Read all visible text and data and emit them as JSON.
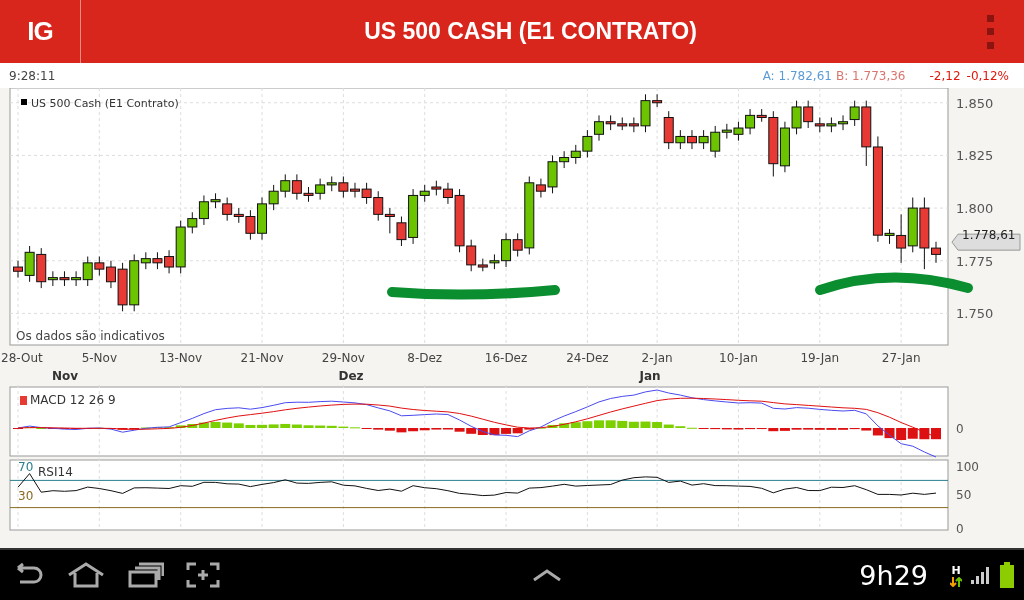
{
  "header": {
    "logo": "IG",
    "title": "US 500 CASH (E1 CONTRATO)"
  },
  "quote": {
    "time": "9:28:11",
    "ask_label": "A:",
    "ask": "1.782,61",
    "bid_label": "B:",
    "bid": "1.773,36",
    "change": "-2,12",
    "change_pct": "-0,12%"
  },
  "price_chart": {
    "legend": "US 500 Cash (E1 Contrato)",
    "note": "Os dados são indicativos",
    "last_price": "1.778,61",
    "chart_data": {
      "type": "candlestick",
      "categories": [
        "28-Out",
        null,
        null,
        null,
        null,
        null,
        null,
        "5-Nov",
        null,
        null,
        null,
        null,
        null,
        null,
        "13-Nov",
        null,
        null,
        null,
        null,
        null,
        null,
        "21-Nov",
        null,
        null,
        null,
        null,
        null,
        null,
        "29-Nov",
        null,
        null,
        null,
        null,
        null,
        null,
        "8-Dez",
        null,
        null,
        null,
        null,
        null,
        null,
        "16-Dez",
        null,
        null,
        null,
        null,
        null,
        null,
        "24-Dez",
        null,
        null,
        null,
        null,
        null,
        "2-Jan",
        null,
        null,
        null,
        null,
        null,
        null,
        "10-Jan",
        null,
        null,
        null,
        null,
        null,
        null,
        "19-Jan",
        null,
        null,
        null,
        null,
        null,
        null,
        "27-Jan",
        null,
        null,
        null
      ],
      "ohlc": [
        [
          1772,
          1775,
          1767,
          1770
        ],
        [
          1768,
          1782,
          1765,
          1779
        ],
        [
          1778,
          1781,
          1762,
          1765
        ],
        [
          1766,
          1770,
          1763,
          1767
        ],
        [
          1767,
          1770,
          1763,
          1766
        ],
        [
          1766,
          1770,
          1763,
          1767
        ],
        [
          1766,
          1777,
          1763,
          1774
        ],
        [
          1774,
          1777,
          1768,
          1771
        ],
        [
          1772,
          1775,
          1762,
          1765
        ],
        [
          1771,
          1774,
          1751,
          1754
        ],
        [
          1754,
          1778,
          1751,
          1775
        ],
        [
          1774,
          1779,
          1771,
          1776
        ],
        [
          1776,
          1779,
          1771,
          1774
        ],
        [
          1777,
          1780,
          1769,
          1772
        ],
        [
          1772,
          1794,
          1769,
          1791
        ],
        [
          1791,
          1798,
          1788,
          1795
        ],
        [
          1795,
          1806,
          1792,
          1803
        ],
        [
          1803,
          1807,
          1800,
          1804
        ],
        [
          1802,
          1805,
          1794,
          1797
        ],
        [
          1797,
          1800,
          1793,
          1796
        ],
        [
          1796,
          1799,
          1785,
          1788
        ],
        [
          1788,
          1805,
          1785,
          1802
        ],
        [
          1802,
          1811,
          1799,
          1808
        ],
        [
          1808,
          1816,
          1805,
          1813
        ],
        [
          1813,
          1816,
          1804,
          1807
        ],
        [
          1807,
          1810,
          1803,
          1806
        ],
        [
          1807,
          1814,
          1804,
          1811
        ],
        [
          1811,
          1815,
          1808,
          1812
        ],
        [
          1812,
          1815,
          1805,
          1808
        ],
        [
          1809,
          1812,
          1805,
          1808
        ],
        [
          1809,
          1812,
          1802,
          1805
        ],
        [
          1805,
          1808,
          1794,
          1797
        ],
        [
          1797,
          1800,
          1788,
          1796
        ],
        [
          1793,
          1796,
          1782,
          1785
        ],
        [
          1786,
          1809,
          1783,
          1806
        ],
        [
          1806,
          1811,
          1803,
          1808
        ],
        [
          1810,
          1813,
          1806,
          1809
        ],
        [
          1809,
          1812,
          1802,
          1805
        ],
        [
          1806,
          1809,
          1779,
          1782
        ],
        [
          1782,
          1785,
          1770,
          1773
        ],
        [
          1773,
          1776,
          1770,
          1772
        ],
        [
          1774,
          1778,
          1771,
          1775
        ],
        [
          1775,
          1788,
          1772,
          1785
        ],
        [
          1785,
          1788,
          1777,
          1780
        ],
        [
          1781,
          1815,
          1778,
          1812
        ],
        [
          1811,
          1814,
          1805,
          1808
        ],
        [
          1810,
          1825,
          1807,
          1822
        ],
        [
          1822,
          1827,
          1819,
          1824
        ],
        [
          1824,
          1830,
          1821,
          1827
        ],
        [
          1827,
          1837,
          1824,
          1834
        ],
        [
          1835,
          1844,
          1832,
          1841
        ],
        [
          1841,
          1844,
          1837,
          1840
        ],
        [
          1840,
          1843,
          1837,
          1839
        ],
        [
          1840,
          1843,
          1836,
          1839
        ],
        [
          1839,
          1854,
          1836,
          1851
        ],
        [
          1851,
          1854,
          1848,
          1850
        ],
        [
          1843,
          1846,
          1828,
          1831
        ],
        [
          1831,
          1837,
          1828,
          1834
        ],
        [
          1834,
          1837,
          1828,
          1831
        ],
        [
          1831,
          1837,
          1828,
          1834
        ],
        [
          1827,
          1839,
          1824,
          1836
        ],
        [
          1836,
          1840,
          1833,
          1837
        ],
        [
          1835,
          1841,
          1832,
          1838
        ],
        [
          1838,
          1847,
          1835,
          1844
        ],
        [
          1844,
          1847,
          1841,
          1843
        ],
        [
          1843,
          1846,
          1815,
          1821
        ],
        [
          1820,
          1841,
          1817,
          1838
        ],
        [
          1838,
          1851,
          1835,
          1848
        ],
        [
          1848,
          1851,
          1838,
          1841
        ],
        [
          1840,
          1843,
          1836,
          1839
        ],
        [
          1839,
          1843,
          1836,
          1840
        ],
        [
          1840,
          1844,
          1837,
          1841
        ],
        [
          1842,
          1851,
          1839,
          1848
        ],
        [
          1848,
          1851,
          1820,
          1829
        ],
        [
          1829,
          1834,
          1784,
          1787
        ],
        [
          1787,
          1790,
          1783,
          1788
        ],
        [
          1787,
          1797,
          1774,
          1781
        ],
        [
          1782,
          1805,
          1779,
          1800
        ],
        [
          1800,
          1805,
          1771,
          1781
        ],
        [
          1781,
          1784,
          1774,
          1778
        ]
      ],
      "ylim": [
        1735,
        1857
      ],
      "grid": true,
      "yticks": [
        {
          "value": 1850,
          "label": "1.850"
        },
        {
          "value": 1825,
          "label": "1.825"
        },
        {
          "value": 1800,
          "label": "1.800"
        },
        {
          "value": 1775,
          "label": "1.775"
        },
        {
          "value": 1750,
          "label": "1.750"
        }
      ]
    },
    "months": [
      "Nov",
      "Dez",
      "Jan"
    ]
  },
  "macd": {
    "legend": "MACD 12 26 9",
    "y_labels": [
      "0"
    ]
  },
  "rsi": {
    "legend": "RSI14",
    "upper": "70",
    "lower": "30",
    "y_labels": [
      "100",
      "50",
      "0"
    ]
  },
  "nav_bar": {
    "clock": "9h29",
    "network": "H"
  }
}
